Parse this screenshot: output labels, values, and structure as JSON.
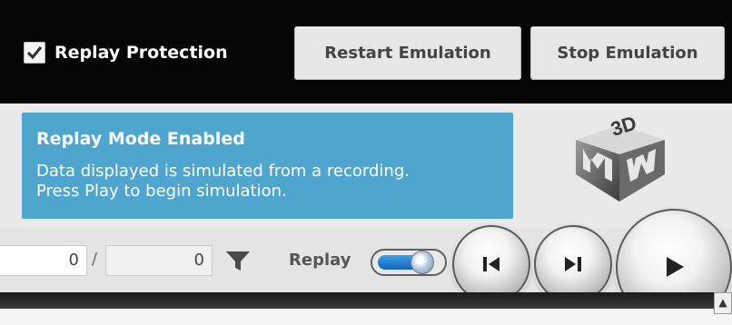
{
  "topbar": {
    "replay_protection": {
      "label": "Replay Protection",
      "checked": true
    },
    "restart_label": "Restart Emulation",
    "stop_label": "Stop Emulation"
  },
  "notice": {
    "title": "Replay Mode Enabled",
    "line1": "Data displayed is simulated from a recording.",
    "line2": "Press Play to begin simulation."
  },
  "logo": {
    "icon": "3dm-logo-icon"
  },
  "controls": {
    "current_value": "0",
    "separator": "/",
    "total_value": "0",
    "filter_icon": "filter-icon",
    "replay_label": "Replay",
    "replay_enabled": true,
    "buttons": [
      "skip-back-icon",
      "skip-forward-icon",
      "play-icon"
    ]
  },
  "colors": {
    "notice_bg": "#4ea6cf",
    "topbar_bg": "#050505",
    "toggle_on": "#2a86d6"
  }
}
